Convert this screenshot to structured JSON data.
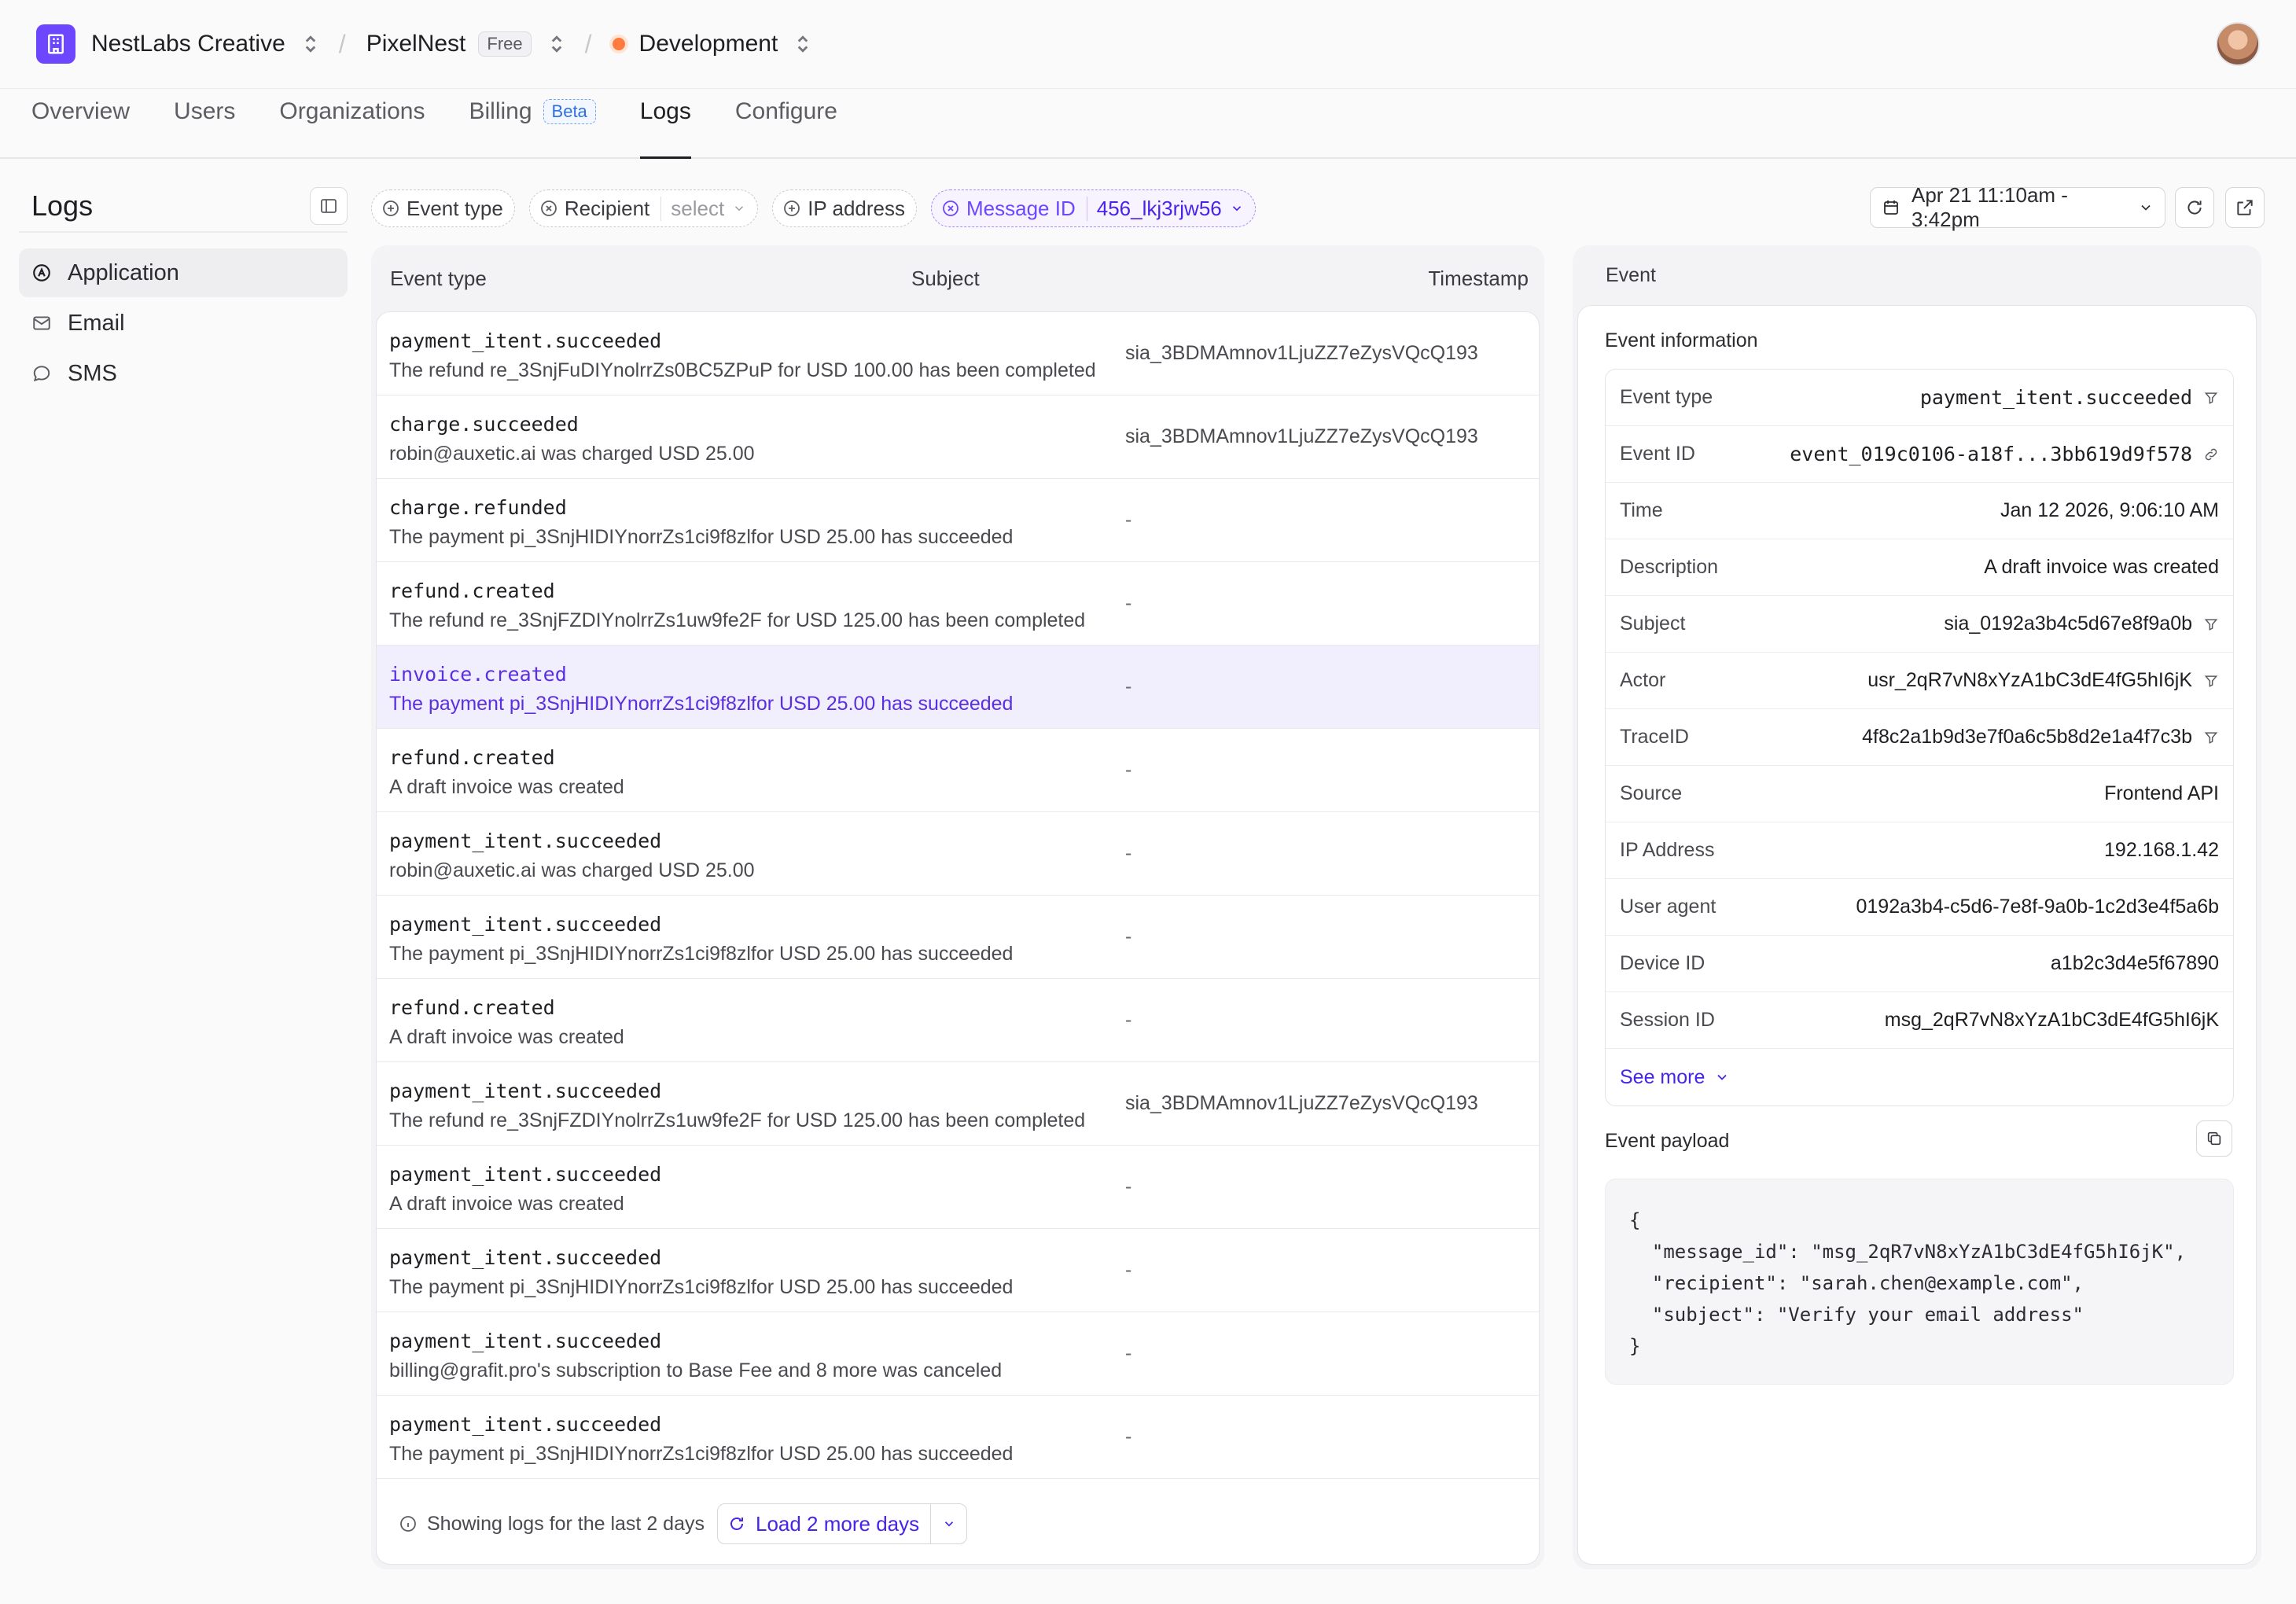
{
  "topbar": {
    "org_name": "NestLabs Creative",
    "app_name": "PixelNest",
    "app_plan": "Free",
    "env_name": "Development",
    "env_color": "#ff7a3d",
    "brand_color": "#6c47ff"
  },
  "nav": {
    "tabs": [
      {
        "label": "Overview"
      },
      {
        "label": "Users"
      },
      {
        "label": "Organizations"
      },
      {
        "label": "Billing",
        "badge": "Beta"
      },
      {
        "label": "Logs",
        "active": true
      },
      {
        "label": "Configure"
      }
    ]
  },
  "sidebar": {
    "title": "Logs",
    "items": [
      {
        "label": "Application",
        "icon": "application-icon",
        "active": true
      },
      {
        "label": "Email",
        "icon": "mail-icon"
      },
      {
        "label": "SMS",
        "icon": "chat-bubble-icon"
      }
    ]
  },
  "filters": {
    "event_type": "Event type",
    "recipient": "Recipient",
    "recipient_placeholder": "select",
    "ip_address": "IP address",
    "message_id": "Message ID",
    "message_id_value": "456_lkj3rjw56"
  },
  "date_range": "Apr 21 11:10am - 3:42pm",
  "table": {
    "headers": {
      "event_type": "Event type",
      "subject": "Subject",
      "timestamp": "Timestamp"
    },
    "rows": [
      {
        "event": "payment_itent.succeeded",
        "desc": "The refund re_3SnjFuDIYnolrrZs0BC5ZPuP for USD 100.00 has been completed",
        "subject": "sia_3BDMAmnov1LjuZZ7eZysVQcQ193"
      },
      {
        "event": "charge.succeeded",
        "desc": "robin@auxetic.ai was charged USD 25.00",
        "subject": "sia_3BDMAmnov1LjuZZ7eZysVQcQ193"
      },
      {
        "event": "charge.refunded",
        "desc": "The payment pi_3SnjHIDIYnorrZs1ci9f8zlfor USD 25.00 has succeeded",
        "subject": "-"
      },
      {
        "event": "refund.created",
        "desc": "The refund re_3SnjFZDIYnolrrZs1uw9fe2F for USD 125.00 has been completed",
        "subject": "-"
      },
      {
        "event": "invoice.created",
        "desc": "The payment pi_3SnjHIDIYnorrZs1ci9f8zlfor USD 25.00 has succeeded",
        "subject": "-",
        "selected": true
      },
      {
        "event": "refund.created",
        "desc": "A draft invoice was created",
        "subject": "-"
      },
      {
        "event": "payment_itent.succeeded",
        "desc": "robin@auxetic.ai was charged USD 25.00",
        "subject": "-"
      },
      {
        "event": "payment_itent.succeeded",
        "desc": "The payment pi_3SnjHIDIYnorrZs1ci9f8zlfor USD 25.00 has succeeded",
        "subject": "-"
      },
      {
        "event": "refund.created",
        "desc": "A draft invoice was created",
        "subject": "-"
      },
      {
        "event": "payment_itent.succeeded",
        "desc": "The refund re_3SnjFZDIYnolrrZs1uw9fe2F for USD 125.00 has been completed",
        "subject": "sia_3BDMAmnov1LjuZZ7eZysVQcQ193"
      },
      {
        "event": "payment_itent.succeeded",
        "desc": "A draft invoice was created",
        "subject": "-"
      },
      {
        "event": "payment_itent.succeeded",
        "desc": "The payment pi_3SnjHIDIYnorrZs1ci9f8zlfor USD 25.00 has succeeded",
        "subject": "-"
      },
      {
        "event": "payment_itent.succeeded",
        "desc": "billing@grafit.pro's subscription to Base Fee and 8 more was canceled",
        "subject": "-"
      },
      {
        "event": "payment_itent.succeeded",
        "desc": "The payment pi_3SnjHIDIYnorrZs1ci9f8zlfor USD 25.00 has succeeded",
        "subject": "-"
      }
    ],
    "footer_text": "Showing logs for the last 2 days",
    "load_more": "Load 2 more days"
  },
  "event": {
    "panel_title": "Event",
    "info_title": "Event information",
    "rows": [
      {
        "key": "Event type",
        "value": "payment_itent.succeeded",
        "mono": true,
        "icon": "filter-icon"
      },
      {
        "key": "Event ID",
        "value": "event_019c0106-a18f...3bb619d9f578",
        "mono": true,
        "icon": "link-icon"
      },
      {
        "key": "Time",
        "value": "Jan 12 2026, 9:06:10 AM"
      },
      {
        "key": "Description",
        "value": "A draft invoice was created"
      },
      {
        "key": "Subject",
        "value": "sia_0192a3b4c5d67e8f9a0b",
        "icon": "filter-icon"
      },
      {
        "key": "Actor",
        "value": "usr_2qR7vN8xYzA1bC3dE4fG5hI6jK",
        "icon": "filter-icon"
      },
      {
        "key": "TraceID",
        "value": "4f8c2a1b9d3e7f0a6c5b8d2e1a4f7c3b",
        "icon": "filter-icon"
      },
      {
        "key": "Source",
        "value": "Frontend API"
      },
      {
        "key": "IP Address",
        "value": "192.168.1.42"
      },
      {
        "key": "User agent",
        "value": "0192a3b4-c5d6-7e8f-9a0b-1c2d3e4f5a6b"
      },
      {
        "key": "Device ID",
        "value": "a1b2c3d4e5f67890"
      },
      {
        "key": "Session ID",
        "value": "msg_2qR7vN8xYzA1bC3dE4fG5hI6jK"
      }
    ],
    "see_more": "See more",
    "payload_title": "Event payload",
    "payload": "{\n  \"message_id\": \"msg_2qR7vN8xYzA1bC3dE4fG5hI6jK\",\n  \"recipient\": \"sarah.chen@example.com\",\n  \"subject\": \"Verify your email address\"\n}"
  }
}
